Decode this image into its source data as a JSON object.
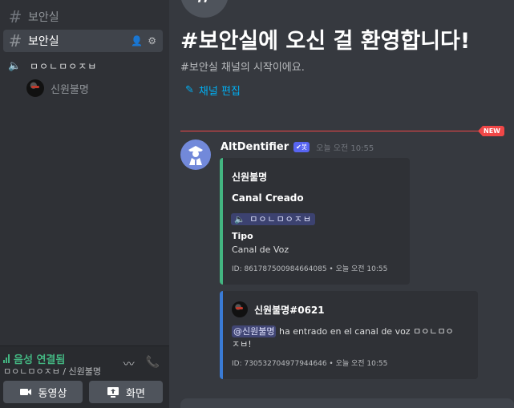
{
  "sidebar": {
    "channels": [
      {
        "name": "보안실",
        "active": false
      },
      {
        "name": "보안실",
        "active": true
      }
    ],
    "voice_channel": "ㅁㅇㄴㅁㅇㅈㅂ",
    "voice_user": "신원불명",
    "voice_panel": {
      "status": "음성 연결됨",
      "sub": "ㅁㅇㄴㅁㅇㅈㅂ / 신원불명",
      "video_label": "동영상",
      "screen_label": "화면"
    }
  },
  "main": {
    "welcome_title": "#보안실에 오신 걸 환영합니다!",
    "welcome_sub": "#보안실 채널의 시작이에요.",
    "edit_channel": "채널 편집",
    "new_badge": "NEW"
  },
  "message": {
    "author": "AltDentifier",
    "bot_badge": "✔봇",
    "timestamp": "오늘 오전 10:55",
    "embed1": {
      "author": "신원불명",
      "title": "Canal Creado",
      "channel_chip": "ㅁㅇㄴㅁㅇㅈㅂ",
      "field_name": "Tipo",
      "field_value": "Canal de Voz",
      "footer": "ID: 861787500984664085 • 오늘 오전 10:55",
      "color": "#43b581"
    },
    "embed2": {
      "author": "신원불명#0621",
      "mention": "@신원불명",
      "text1": " ha entrado en el canal de voz ㅁㅇㄴㅁㅇ",
      "text2": "ㅈㅂ!",
      "footer": "ID: 730532704977944646 • 오늘 오전 10:55",
      "color": "#3a7bd5"
    }
  },
  "colors": {
    "accent": "#5865f2",
    "green": "#43b581",
    "red": "#f04747",
    "link": "#00b0f4"
  }
}
